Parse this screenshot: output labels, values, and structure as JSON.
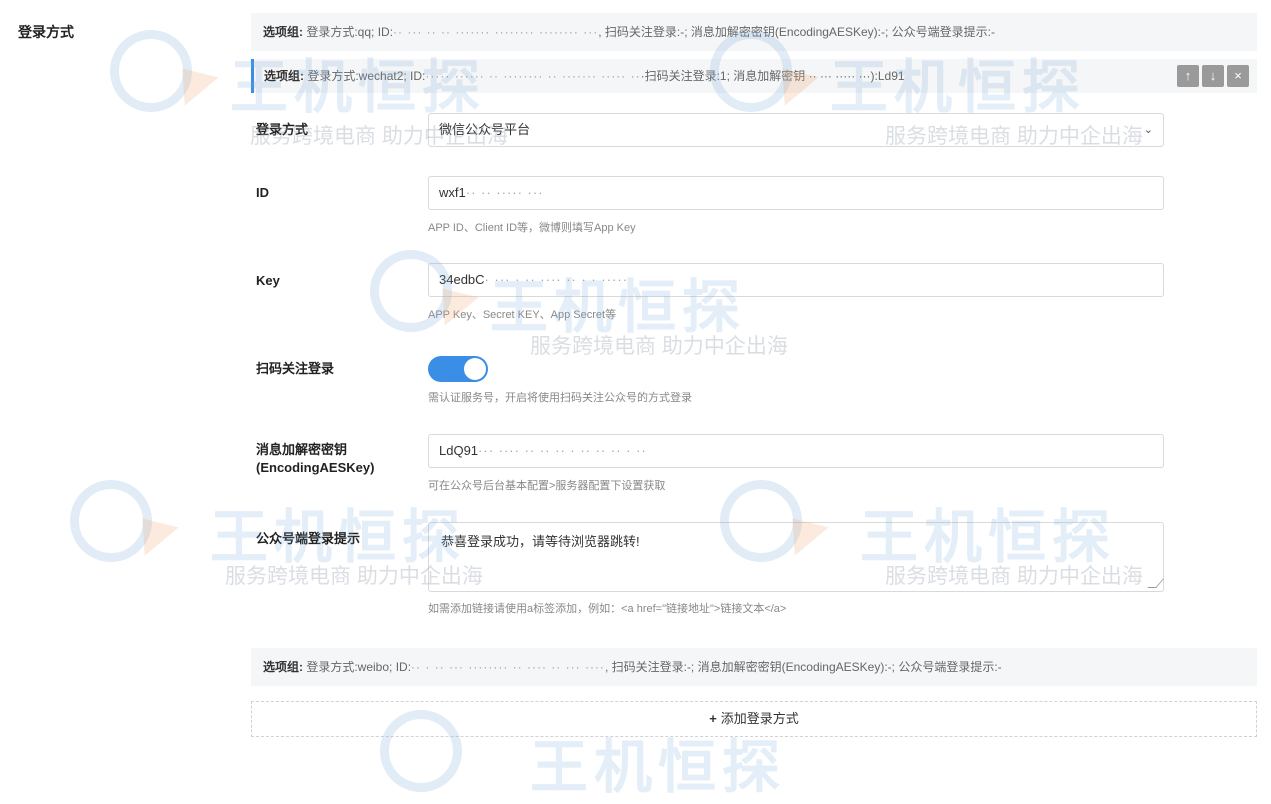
{
  "section_label": "登录方式",
  "groups": [
    {
      "tag": "选项组:",
      "text": "登录方式:qq; ID:",
      "blurred": "·· ··· ·· ·· ······· ········ ········ ···",
      "tail": ", 扫码关注登录:-; 消息加解密密钥(EncodingAESKey):-; 公众号端登录提示:-"
    },
    {
      "tag": "选项组:",
      "text": "登录方式:wechat2; ID:",
      "blurred": "····· ······ ·· ········ ·· ······· ····· ··",
      "tail": "·扫码关注登录:1; 消息加解密钥 ·· ··· ····· ···):Ld91"
    },
    {
      "tag": "选项组:",
      "text": "登录方式:weibo; ID:",
      "blurred": "·· · ·· ··· ········ ·· ···· ·· ··· ····",
      "tail": ", 扫码关注登录:-; 消息加解密密钥(EncodingAESKey):-; 公众号端登录提示:-"
    }
  ],
  "group_actions": {
    "up": "↑",
    "down": "↓",
    "close": "×"
  },
  "form": {
    "login_method": {
      "label": "登录方式",
      "value": "微信公众号平台"
    },
    "id": {
      "label": "ID",
      "value": "wxf1",
      "blurred": "·· ·· ····· ···",
      "help": "APP ID、Client ID等，微博则填写App Key"
    },
    "key": {
      "label": "Key",
      "value": "34edbC",
      "blurred": "· ··· · ·· ···· ·· · ·  ·····",
      "help": "APP Key、Secret KEY、App Secret等"
    },
    "scan_login": {
      "label": "扫码关注登录",
      "enabled": true,
      "help": "需认证服务号，开启将使用扫码关注公众号的方式登录"
    },
    "aes_key": {
      "label1": "消息加解密密钥",
      "label2": "(EncodingAESKey)",
      "value": "LdQ91",
      "blurred": "··· ····  ·· ·· ·· · ·· ·· ·· · ··",
      "help": "可在公众号后台基本配置>服务器配置下设置获取"
    },
    "login_tip": {
      "label": "公众号端登录提示",
      "value": "恭喜登录成功，请等待浏览器跳转!",
      "help": "如需添加链接请使用a标签添加，例如：<a href=\"链接地址\">链接文本</a>"
    }
  },
  "add_button": {
    "icon": "+",
    "label": "添加登录方式"
  },
  "watermark": {
    "big": "王机恒探",
    "small": "服务跨境电商 助力中企出海"
  },
  "colors": {
    "accent": "#3a8ee6",
    "panel_bg": "#f5f6f7"
  }
}
